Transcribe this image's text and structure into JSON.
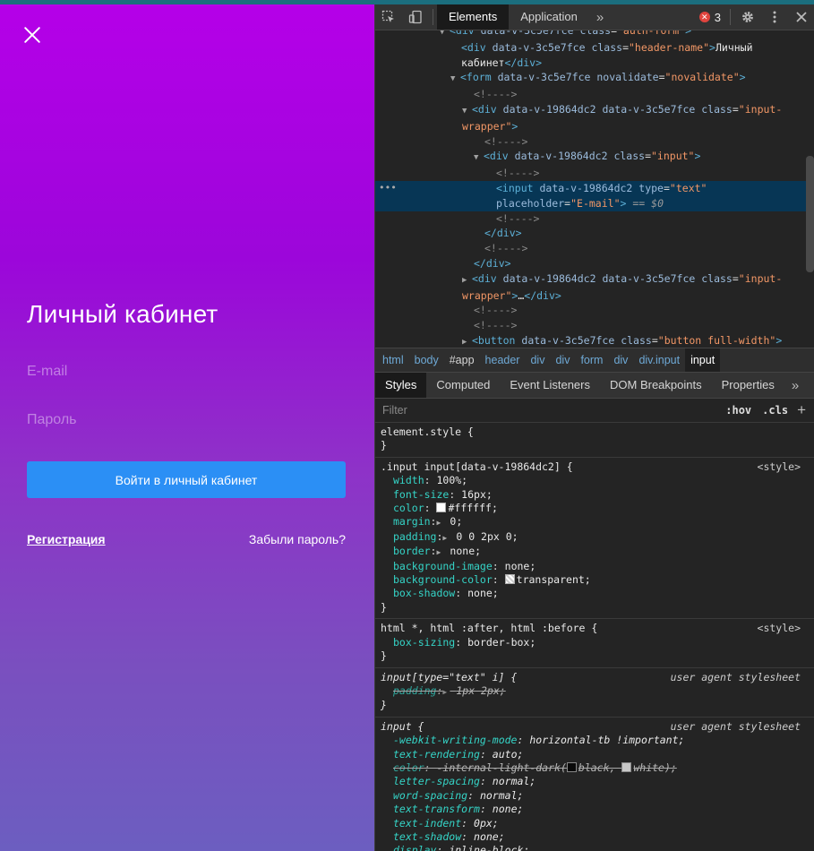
{
  "page": {
    "title": "Личный кабинет",
    "email_placeholder": "E-mail",
    "password_placeholder": "Пароль",
    "login_button": "Войти в личный кабинет",
    "register_link": "Регистрация",
    "forgot_link": "Забыли пароль?"
  },
  "devtools": {
    "tabs": [
      "Elements",
      "Application"
    ],
    "more": "»",
    "error_count": "3",
    "breadcrumbs": [
      "html",
      "body",
      "#app",
      "header",
      "div",
      "div",
      "form",
      "div",
      "div.input",
      "input"
    ],
    "style_tabs": [
      "Styles",
      "Computed",
      "Event Listeners",
      "DOM Breakpoints",
      "Properties"
    ],
    "filter_placeholder": "Filter",
    "hov": ":hov",
    "cls": ".cls",
    "plus": "+",
    "colors": {
      "accent_button": "#2b8ff5",
      "selected_row": "#073655",
      "error": "#e0443e"
    }
  }
}
